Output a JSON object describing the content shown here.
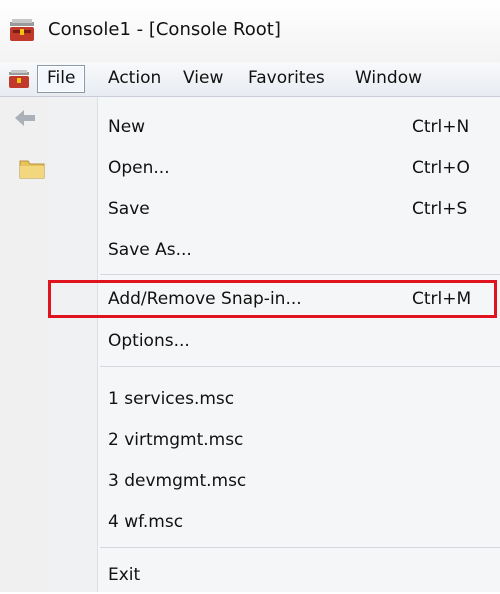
{
  "window": {
    "title": "Console1 - [Console Root]"
  },
  "menubar": {
    "items": [
      {
        "label": "File",
        "active": true
      },
      {
        "label": "Action"
      },
      {
        "label": "View"
      },
      {
        "label": "Favorites"
      },
      {
        "label": "Window"
      }
    ]
  },
  "file_menu": {
    "items": [
      {
        "label": "New",
        "shortcut": "Ctrl+N"
      },
      {
        "label": "Open...",
        "shortcut": "Ctrl+O"
      },
      {
        "label": "Save",
        "shortcut": "Ctrl+S"
      },
      {
        "label": "Save As...",
        "shortcut": ""
      },
      {
        "label": "Add/Remove Snap-in...",
        "shortcut": "Ctrl+M",
        "highlighted": true
      },
      {
        "label": "Options...",
        "shortcut": ""
      },
      {
        "label": "1 services.msc",
        "shortcut": ""
      },
      {
        "label": "2 virtmgmt.msc",
        "shortcut": ""
      },
      {
        "label": "3 devmgmt.msc",
        "shortcut": ""
      },
      {
        "label": "4 wf.msc",
        "shortcut": ""
      },
      {
        "label": "Exit",
        "shortcut": ""
      }
    ]
  },
  "icons": {
    "app": "mmc-toolbox-icon",
    "back": "back-arrow-icon",
    "tree_node": "folder-icon"
  },
  "colors": {
    "highlight_border": "#e0141e",
    "menu_background": "#f5f6f7"
  }
}
